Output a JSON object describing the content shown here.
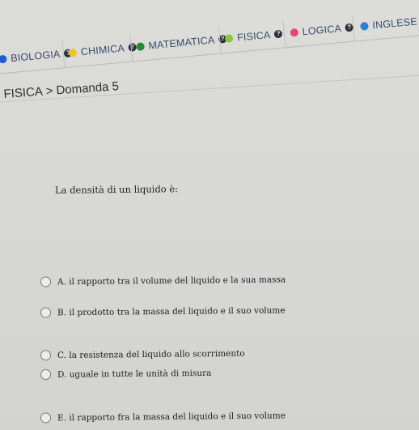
{
  "tabs": [
    {
      "label": "BIOLOGIA",
      "dot_color": "#1d5bd6"
    },
    {
      "label": "CHIMICA",
      "dot_color": "#f2c12e"
    },
    {
      "label": "MATEMATICA",
      "dot_color": "#1f8a2e"
    },
    {
      "label": "FISICA",
      "dot_color": "#8cc63f"
    },
    {
      "label": "LOGICA",
      "dot_color": "#e84a6b"
    },
    {
      "label": "INGLESE",
      "dot_color": "#2f7fd1"
    }
  ],
  "info_glyph": "?",
  "breadcrumb": {
    "subject": "FISICA",
    "separator": ">",
    "question": "Domanda 5"
  },
  "question": {
    "text": "La densità di un liquido è:"
  },
  "options": [
    {
      "label": "A. il rapporto tra il volume del liquido e la sua massa"
    },
    {
      "label": "B. il prodotto tra la massa del liquido e il suo volume"
    },
    {
      "label": "C. la resistenza del liquido allo scorrimento"
    },
    {
      "label": "D. uguale in tutte le unità di misura"
    },
    {
      "label": "E. il rapporto fra la massa del liquido e il suo volume"
    }
  ]
}
